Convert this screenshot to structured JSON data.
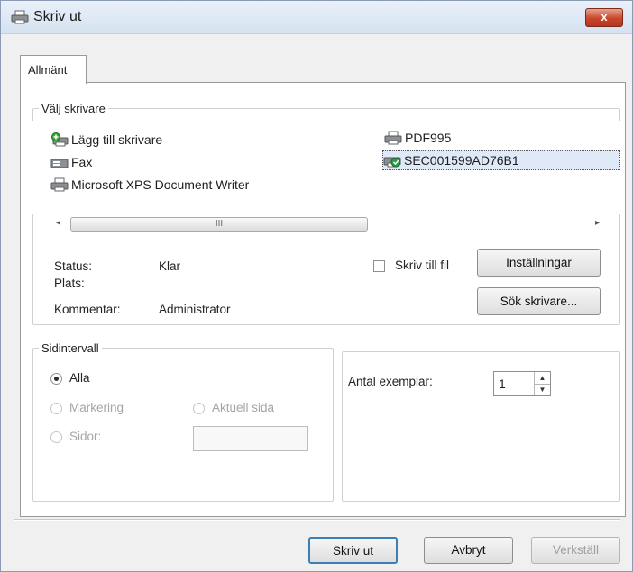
{
  "window": {
    "title": "Skriv ut",
    "close_symbol": "x"
  },
  "tabs": [
    {
      "label": "Allmänt"
    }
  ],
  "printer_group": {
    "legend": "Välj skrivare",
    "printers": [
      {
        "name": "Lägg till skrivare",
        "icon": "add-printer-icon"
      },
      {
        "name": "Fax",
        "icon": "fax-printer-icon"
      },
      {
        "name": "Microsoft XPS Document Writer",
        "icon": "printer-icon"
      },
      {
        "name": "PDF995",
        "icon": "printer-icon"
      },
      {
        "name": "SEC001599AD76B1",
        "icon": "default-printer-icon",
        "selected": true
      }
    ],
    "scroll_thumb_grip": "III",
    "status_label": "Status:",
    "status_value": "Klar",
    "location_label": "Plats:",
    "location_value": "",
    "comment_label": "Kommentar:",
    "comment_value": "Administrator",
    "print_to_file_label": "Skriv till fil",
    "preferences_button": "Inställningar",
    "find_printer_button": "Sök skrivare..."
  },
  "page_range": {
    "legend": "Sidintervall",
    "all_label": "Alla",
    "selection_label": "Markering",
    "current_page_label": "Aktuell sida",
    "pages_label": "Sidor:",
    "pages_value": ""
  },
  "copies": {
    "label": "Antal exemplar:",
    "value": "1"
  },
  "buttons": {
    "print": "Skriv ut",
    "cancel": "Avbryt",
    "apply": "Verkställ"
  },
  "colors": {
    "selection_bg": "#dfe9f7",
    "close_button": "#c9462c",
    "titlebar": "#d6e2f1"
  }
}
